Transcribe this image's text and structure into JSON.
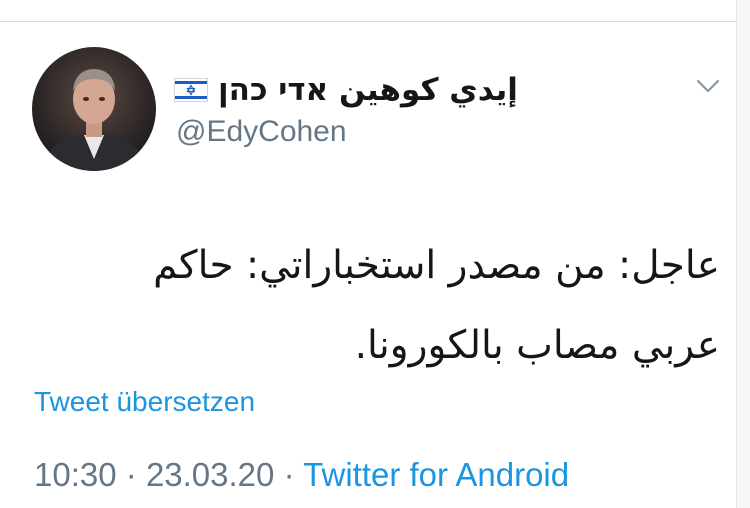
{
  "tweet": {
    "author": {
      "display_name": "إيدي كوهين אדי כהן",
      "handle": "@EdyCohen",
      "flag_icon": "israel-flag-icon"
    },
    "text": "عاجل: من مصدر استخباراتي: حاكم\nعربي مصاب بالكورونا.",
    "translate_label": "Tweet übersetzen",
    "time": "10:30",
    "separator": "·",
    "date": "23.03.20",
    "source": "Twitter for Android"
  },
  "icons": {
    "menu": "chevron-down-icon"
  },
  "colors": {
    "link_blue": "#1b95e0",
    "secondary_gray": "#657786",
    "text_dark": "#14171a"
  }
}
